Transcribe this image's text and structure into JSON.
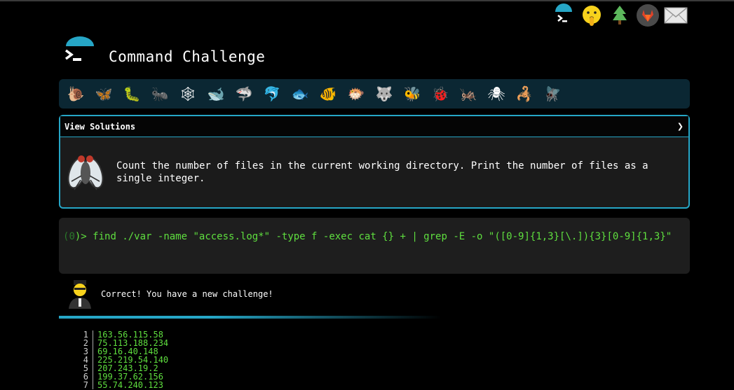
{
  "app": {
    "title": "Command Challenge"
  },
  "top_icons": [
    "terminal-logo-icon",
    "shushing-face-icon",
    "tree-icon",
    "gitlab-icon",
    "mail-icon"
  ],
  "critters": [
    {
      "name": "snail-icon",
      "glyph": "🐌"
    },
    {
      "name": "butterfly-icon",
      "glyph": "🦋"
    },
    {
      "name": "caterpillar-icon",
      "glyph": "🐛"
    },
    {
      "name": "ant-icon",
      "glyph": "🐜"
    },
    {
      "name": "spiderweb-icon",
      "glyph": "🕸"
    },
    {
      "name": "whale-icon",
      "glyph": "🐋"
    },
    {
      "name": "shark-icon",
      "glyph": "🦈"
    },
    {
      "name": "dolphin-icon",
      "glyph": "🐬"
    },
    {
      "name": "fish-icon",
      "glyph": "🐟"
    },
    {
      "name": "tropical-fish-icon",
      "glyph": "🐠"
    },
    {
      "name": "blowfish-icon",
      "glyph": "🐡"
    },
    {
      "name": "wolf-icon",
      "glyph": "🐺"
    },
    {
      "name": "bee-icon",
      "glyph": "🐝"
    },
    {
      "name": "ladybug-icon",
      "glyph": "🐞"
    },
    {
      "name": "cricket-icon",
      "glyph": "🦗"
    },
    {
      "name": "spider-icon",
      "glyph": "🕷"
    },
    {
      "name": "scorpion-icon",
      "glyph": "🦂"
    },
    {
      "name": "fly-icon",
      "glyph": "🪰"
    }
  ],
  "challenge": {
    "view_solutions_label": "View Solutions",
    "chevron": "❯",
    "description": "Count the number of files in the current working directory. Print the number of files as a single integer."
  },
  "terminal": {
    "prompt_open": "(",
    "prompt_num": "0",
    "prompt_close": ")> ",
    "command": "find ./var -name \"access.log*\" -type f -exec cat {} + | grep -E -o \"([0-9]{1,3}[\\.]){3}[0-9]{1,3}\""
  },
  "result": {
    "message": "Correct! You have a new challenge!"
  },
  "output": {
    "rows": [
      {
        "n": "1",
        "v": "163.56.115.58"
      },
      {
        "n": "2",
        "v": "75.113.188.234"
      },
      {
        "n": "3",
        "v": "69.16.40.148"
      },
      {
        "n": "4",
        "v": "225.219.54.140"
      },
      {
        "n": "5",
        "v": "207.243.19.2"
      },
      {
        "n": "6",
        "v": "199.37.62.156"
      },
      {
        "n": "7",
        "v": "55.74.240.123"
      }
    ]
  },
  "colors": {
    "accent": "#26a6c6",
    "terminal_green": "#5fdf3f",
    "critter_bar": "#0b2733"
  }
}
